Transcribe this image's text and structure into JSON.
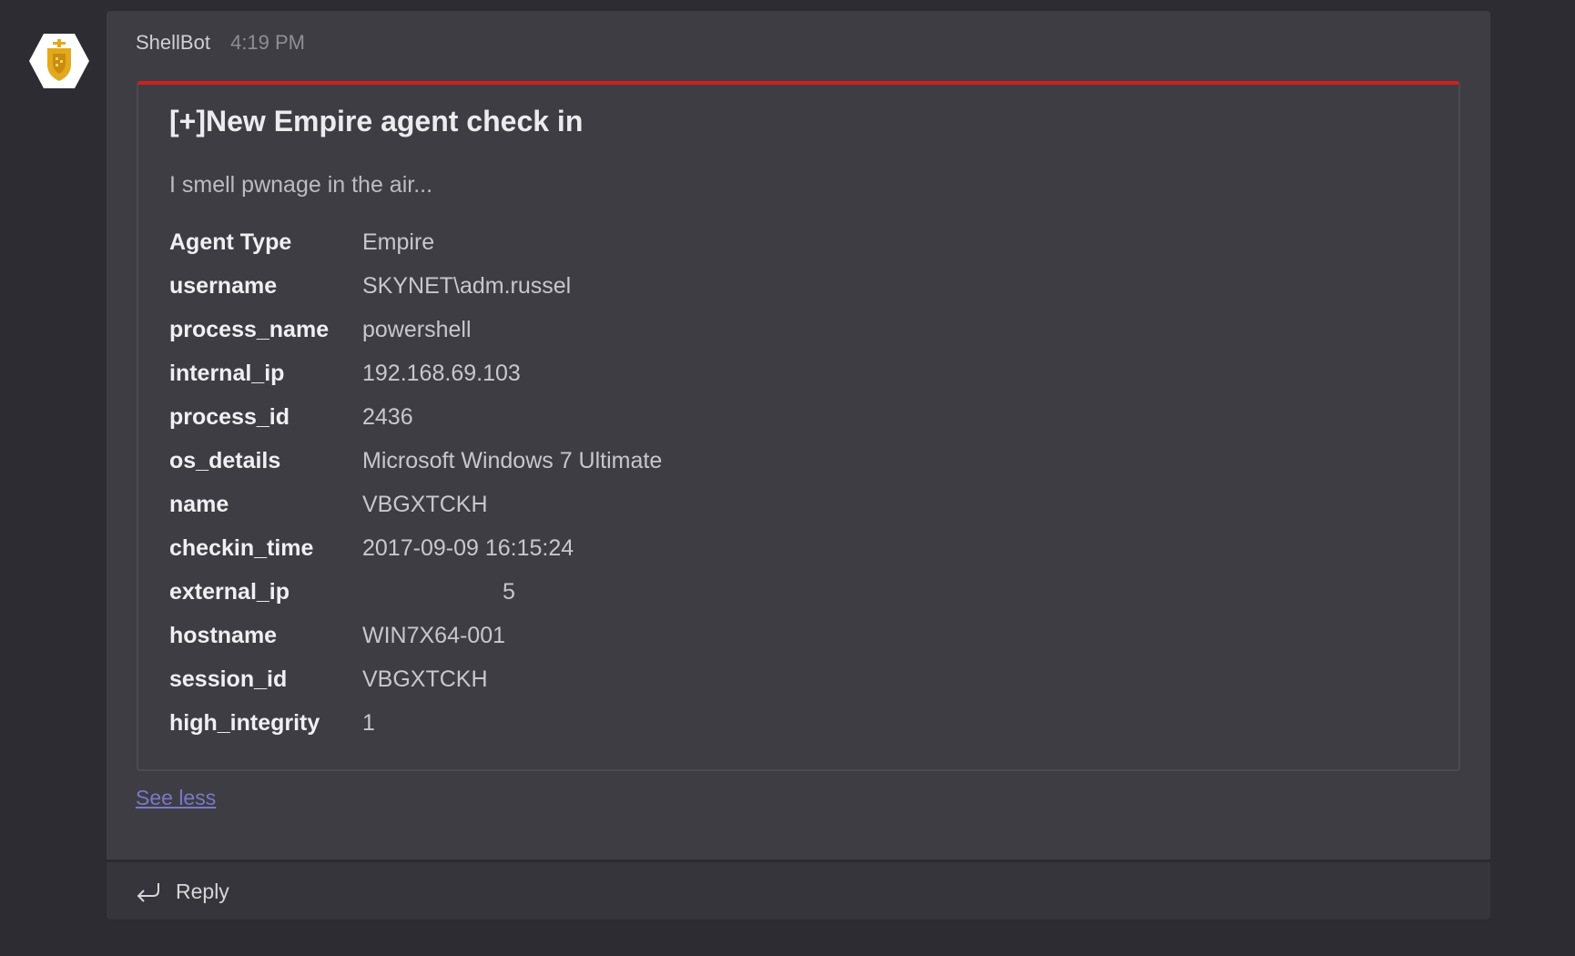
{
  "message": {
    "author": "ShellBot",
    "time": "4:19 PM",
    "avatar_icon": "shield-badge-icon"
  },
  "card": {
    "accent_color": "#cf1f1f",
    "title": "[+]New Empire agent check in",
    "subtitle": "I smell pwnage in the air...",
    "facts": [
      {
        "key": "Agent Type",
        "value": "Empire"
      },
      {
        "key": "username",
        "value": "SKYNET\\adm.russel"
      },
      {
        "key": "process_name",
        "value": "powershell"
      },
      {
        "key": "internal_ip",
        "value": "192.168.69.103"
      },
      {
        "key": "process_id",
        "value": "2436"
      },
      {
        "key": "os_details",
        "value": "Microsoft Windows 7 Ultimate"
      },
      {
        "key": "name",
        "value": "VBGXTCKH"
      },
      {
        "key": "checkin_time",
        "value": "2017-09-09 16:15:24"
      },
      {
        "key": "external_ip",
        "value": "5"
      },
      {
        "key": "hostname",
        "value": "WIN7X64-001"
      },
      {
        "key": "session_id",
        "value": "VBGXTCKH"
      },
      {
        "key": "high_integrity",
        "value": "1"
      }
    ]
  },
  "see_less_label": "See less",
  "reply": {
    "label": "Reply",
    "icon": "reply-arrow-icon"
  }
}
